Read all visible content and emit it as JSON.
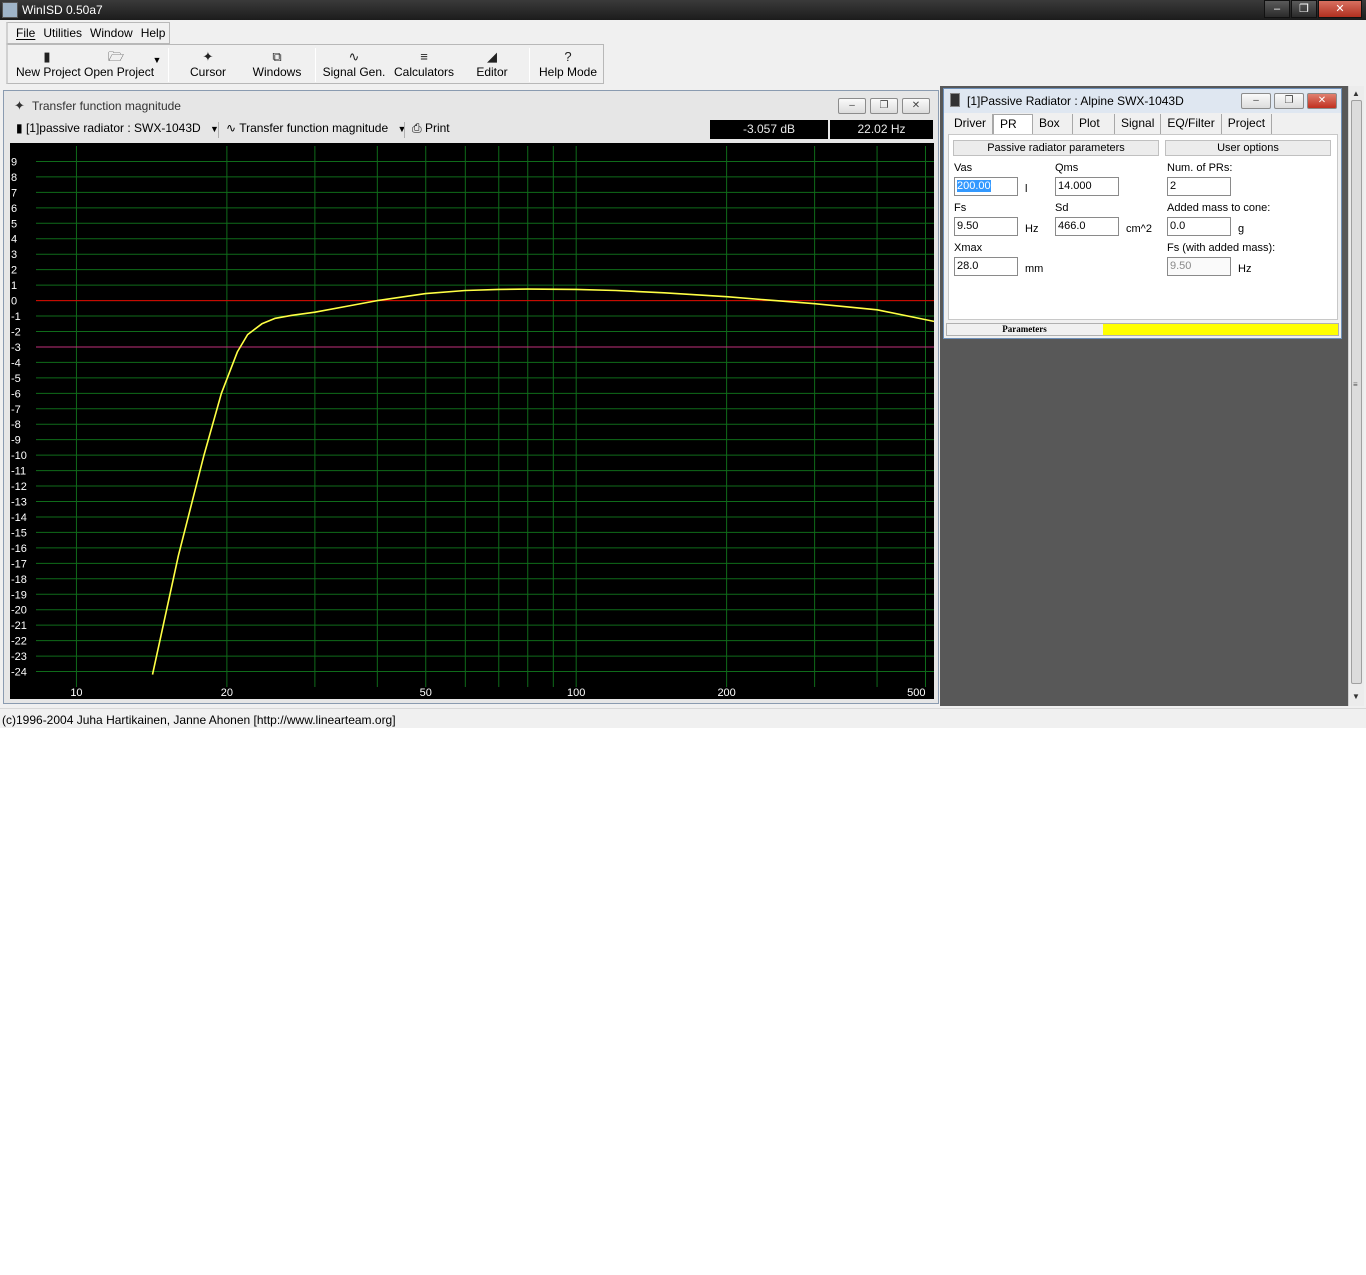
{
  "app": {
    "title": "WinISD 0.50a7"
  },
  "menu": [
    {
      "label": "File"
    },
    {
      "label": "Utilities"
    },
    {
      "label": "Window"
    },
    {
      "label": "Help"
    }
  ],
  "toolbar": {
    "new_project": "New Project",
    "open_project": "Open Project",
    "cursor": "Cursor",
    "windows": "Windows",
    "signal_gen": "Signal Gen.",
    "calculators": "Calculators",
    "editor": "Editor",
    "help_mode": "Help Mode"
  },
  "graph_window": {
    "title": "Transfer function magnitude",
    "project_select": "[1]passive radiator : SWX-1043D",
    "graph_type_select": "Transfer function magnitude",
    "print_label": "Print",
    "readout_db": "-3.057 dB",
    "readout_hz": "22.02 Hz"
  },
  "chart_data": {
    "type": "line",
    "title": "",
    "xlabel": "",
    "ylabel": "",
    "x_scale": "log",
    "xlim": [
      8.3,
      520
    ],
    "ylim": [
      -25,
      10
    ],
    "x_tick_labels": [
      "10",
      "20",
      "50",
      "100",
      "200",
      "500"
    ],
    "y_tick_labels": [
      "9",
      "8",
      "7",
      "6",
      "5",
      "4",
      "3",
      "2",
      "1",
      "0",
      "-1",
      "-2",
      "-3",
      "-4",
      "-5",
      "-6",
      "-7",
      "-8",
      "-9",
      "-10",
      "-11",
      "-12",
      "-13",
      "-14",
      "-15",
      "-16",
      "-17",
      "-18",
      "-19",
      "-20",
      "-21",
      "-22",
      "-23",
      "-24"
    ],
    "grid": true,
    "reference_lines": [
      {
        "y": 0,
        "color": "#e00000"
      },
      {
        "y": -3,
        "color": "#c0307a"
      }
    ],
    "series": [
      {
        "color": "#ffff44",
        "x": [
          14.2,
          16,
          18,
          19.5,
          21,
          22,
          23.5,
          25,
          27,
          30,
          35,
          40,
          50,
          60,
          70,
          80,
          100,
          120,
          150,
          200,
          250,
          300,
          400,
          520
        ],
        "y": [
          -24.2,
          -16.5,
          -10,
          -6,
          -3.3,
          -2.2,
          -1.5,
          -1.15,
          -0.95,
          -0.75,
          -0.35,
          0.0,
          0.45,
          0.65,
          0.72,
          0.74,
          0.72,
          0.65,
          0.5,
          0.25,
          0.0,
          -0.2,
          -0.6,
          -1.35
        ]
      }
    ]
  },
  "pr_window": {
    "title": "[1]Passive Radiator : Alpine SWX-1043D",
    "tabs": [
      {
        "label": "Driver"
      },
      {
        "label": "PR"
      },
      {
        "label": "Box"
      },
      {
        "label": "Plot"
      },
      {
        "label": "Signal"
      },
      {
        "label": "EQ/Filter"
      },
      {
        "label": "Project"
      }
    ],
    "section_params": "Passive radiator parameters",
    "section_user": "User options",
    "vas": {
      "label": "Vas",
      "value": "200.00",
      "unit": "l"
    },
    "qms": {
      "label": "Qms",
      "value": "14.000"
    },
    "fs": {
      "label": "Fs",
      "value": "9.50",
      "unit": "Hz"
    },
    "sd": {
      "label": "Sd",
      "value": "466.0",
      "unit": "cm^2"
    },
    "xmax": {
      "label": "Xmax",
      "value": "28.0",
      "unit": "mm"
    },
    "num_prs": {
      "label": "Num. of PRs:",
      "value": "2"
    },
    "added_mass": {
      "label": "Added mass to cone:",
      "value": "0.0",
      "unit": "g"
    },
    "fs_added": {
      "label": "Fs (with added mass):",
      "value": "9.50",
      "unit": "Hz"
    },
    "status_label": "Parameters"
  },
  "statusbar": {
    "text": "(c)1996-2004 Juha Hartikainen, Janne Ahonen [http://www.linearteam.org]"
  }
}
